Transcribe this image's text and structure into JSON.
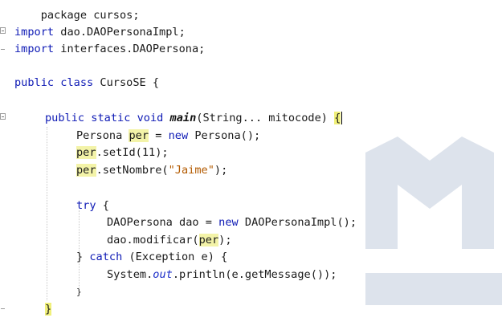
{
  "editor": {
    "top_line": "package cursos;",
    "lines": {
      "import1": {
        "kw": "import",
        "rest": " dao.DAOPersonaImpl;"
      },
      "import2": {
        "kw": "import",
        "rest": " interfaces.DAOPersona;"
      },
      "class_decl": {
        "kw1": "public",
        "kw2": "class",
        "name": " CursoSE {"
      },
      "main_decl": {
        "kw1": "public",
        "kw2": "static",
        "kw3": "void",
        "method": "main",
        "params": "(String... mitocode) ",
        "brace": "{"
      },
      "persona_new": {
        "type": "Persona ",
        "var": "per",
        "mid": " = ",
        "kw": "new",
        "rest": " Persona();"
      },
      "set_id": {
        "var": "per",
        "rest": ".setId(11);"
      },
      "set_nombre": {
        "var": "per",
        "mid": ".setNombre(",
        "str": "\"Jaime\"",
        "end": ");"
      },
      "try_open": {
        "kw": "try",
        "rest": " {"
      },
      "dao_new": {
        "type": "DAOPersona dao = ",
        "kw": "new",
        "rest": " DAOPersonaImpl();"
      },
      "modificar": {
        "pre": "dao.modificar(",
        "var": "per",
        "end": ");"
      },
      "catch_line": {
        "pre": "} ",
        "kw": "catch",
        "rest": " (Exception e) {"
      },
      "println": {
        "pre": "System.",
        "field": "out",
        "rest": ".println(e.getMessage());"
      },
      "close_try": {
        "text": "}"
      },
      "close_main": {
        "text": "}"
      }
    }
  }
}
